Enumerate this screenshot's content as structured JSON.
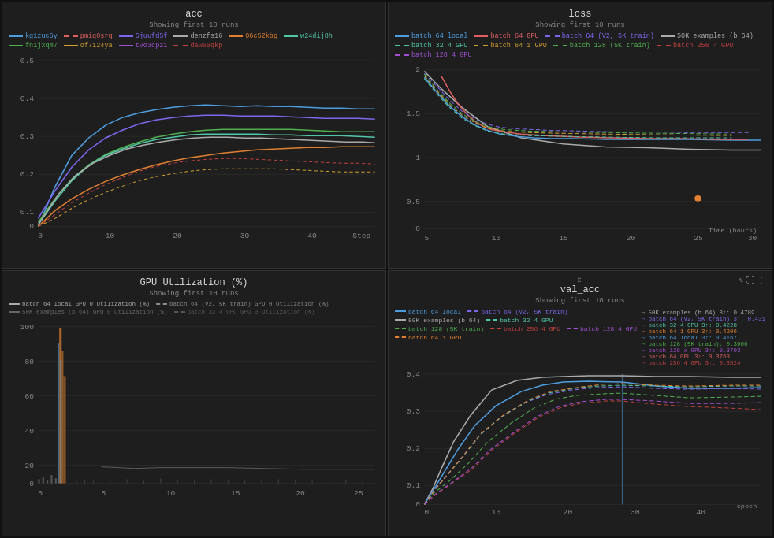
{
  "panels": {
    "acc": {
      "title": "acc",
      "subtitle": "Showing first 10 runs",
      "legend": [
        {
          "label": "kg1zuc6y",
          "color": "#4e9de0",
          "dash": false
        },
        {
          "label": "pmiq0srq",
          "color": "#e06060",
          "dash": true
        },
        {
          "label": "5juufd5f",
          "color": "#7b68ee",
          "dash": false
        },
        {
          "label": "denzfs16",
          "color": "#aaaaaa",
          "dash": false
        },
        {
          "label": "06c52kbg",
          "color": "#e08030",
          "dash": false
        },
        {
          "label": "w24dij8h",
          "color": "#50c8a8",
          "dash": false
        },
        {
          "label": "fn1jxqm7",
          "color": "#50b050",
          "dash": false
        },
        {
          "label": "of7124ya",
          "color": "#d4a030",
          "dash": false
        },
        {
          "label": "tvo3cpz1",
          "color": "#a050d0",
          "dash": false
        },
        {
          "label": "daw66qkp",
          "color": "#c04040",
          "dash": true
        }
      ],
      "xaxis": "Step",
      "yticks": [
        "0.5",
        "0.4",
        "0.3",
        "0.2",
        "0.1",
        "0"
      ]
    },
    "loss": {
      "title": "loss",
      "subtitle": "Showing first 10 runs",
      "legend": [
        {
          "label": "batch 64 local",
          "color": "#4e9de0",
          "dash": false
        },
        {
          "label": "batch 64 GPU",
          "color": "#e06060",
          "dash": false
        },
        {
          "label": "batch 64 (V2, 5K train)",
          "color": "#7b68ee",
          "dash": true
        },
        {
          "label": "50K examples (b 64)",
          "color": "#aaaaaa",
          "dash": false
        },
        {
          "label": "batch 32 4 GPU",
          "color": "#50c8a8",
          "dash": true
        },
        {
          "label": "batch 64 1 GPU",
          "color": "#d4a030",
          "dash": true
        },
        {
          "label": "batch 128 (5K train)",
          "color": "#50b050",
          "dash": true
        },
        {
          "label": "batch 256 4 GPU",
          "color": "#c04040",
          "dash": true
        },
        {
          "label": "batch 128 4 GPU",
          "color": "#a050d0",
          "dash": true
        }
      ],
      "xaxis": "Time (hours)",
      "yticks": [
        "2",
        "1.5",
        "1",
        "0.5",
        "0"
      ]
    },
    "gpu": {
      "title": "GPU Utilization (%)",
      "subtitle": "Showing first 10 runs",
      "legend": [
        {
          "label": "batch 64 local GPU 0 Utilization (%)",
          "color": "#aaaaaa",
          "dash": false
        },
        {
          "label": "batch 64 (V2, 5K train) GPU 0 Utilization (%)",
          "color": "#888888",
          "dash": true
        },
        {
          "label": "batch 64 (V2, 5K train) GPU 0 Utilization (%)",
          "color": "#888888",
          "dash": true
        },
        {
          "label": "50K examples (b 64) GPU 0 Utilization (%)",
          "color": "#666666",
          "dash": false
        },
        {
          "label": "batch 32 4 GPU GPU 0 Utilization (%)",
          "color": "#555555",
          "dash": true
        }
      ],
      "xaxis": "",
      "yticks": [
        "100",
        "80",
        "60",
        "40",
        "20",
        "0"
      ]
    },
    "val_acc": {
      "title": "val_acc",
      "subtitle": "Showing first 10 runs",
      "legend": [
        {
          "label": "batch 64 local",
          "color": "#4e9de0",
          "dash": false
        },
        {
          "label": "batch 64 (V2, 5K train)",
          "color": "#7b68ee",
          "dash": true
        },
        {
          "label": "50K examples (b 64)",
          "color": "#aaaaaa",
          "dash": false
        },
        {
          "label": "batch 32 4 GPU",
          "color": "#50c8a8",
          "dash": true
        },
        {
          "label": "batch 128 (5K train)",
          "color": "#50b050",
          "dash": true
        },
        {
          "label": "batch 256 4 GPU",
          "color": "#c04040",
          "dash": true
        },
        {
          "label": "batch 128 4 GPU",
          "color": "#a050d0",
          "dash": true
        },
        {
          "label": "batch 64 1 GPU",
          "color": "#e08030",
          "dash": true
        }
      ],
      "annotations": [
        {
          "label": "50K examples (b 64) 3↑: 0.4789",
          "color": "#aaaaaa"
        },
        {
          "label": "batch 64 (V2, 5K train) 3↑: 0.431",
          "color": "#7b68ee"
        },
        {
          "label": "batch 32 4 GPU 3↑: 0.4228",
          "color": "#50c8a8"
        },
        {
          "label": "batch 64 1 GPU 3↑: 0.4206",
          "color": "#e08030"
        },
        {
          "label": "batch 64 local 3↑: 0.4167",
          "color": "#4e9de0"
        },
        {
          "label": "batch 128 (5K train): 0.3906",
          "color": "#50b050"
        },
        {
          "label": "batch 128 x GPU 3↑: 0.3793",
          "color": "#a050d0"
        },
        {
          "label": "batch 64 GPU 3↑: 0.3763",
          "color": "#e06060"
        },
        {
          "label": "batch 256 4 GPU 3↑: 0.3524",
          "color": "#c04040"
        }
      ],
      "xaxis": "epoch",
      "yticks": [
        "0.4",
        "0.3",
        "0.2",
        "0.1",
        "0"
      ]
    }
  }
}
